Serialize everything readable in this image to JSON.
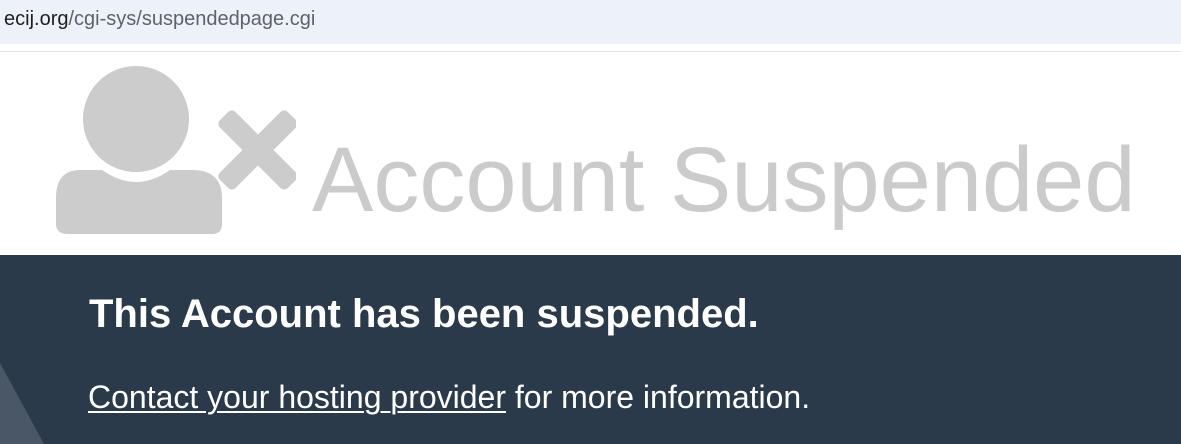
{
  "address_bar": {
    "domain": "ecij.org",
    "path": "/cgi-sys/suspendedpage.cgi"
  },
  "header": {
    "icon": "user-x-icon",
    "headline": "Account Suspended"
  },
  "notice": {
    "title": "This Account has been suspended.",
    "link_text": "Contact your hosting provider",
    "trailing_text": " for more information."
  },
  "colors": {
    "address_bar_bg": "#edf2fa",
    "icon_gray": "#cccccc",
    "headline_gray": "#cbcbcb",
    "band_bg": "#2b3a4b",
    "text_white": "#ffffff"
  }
}
